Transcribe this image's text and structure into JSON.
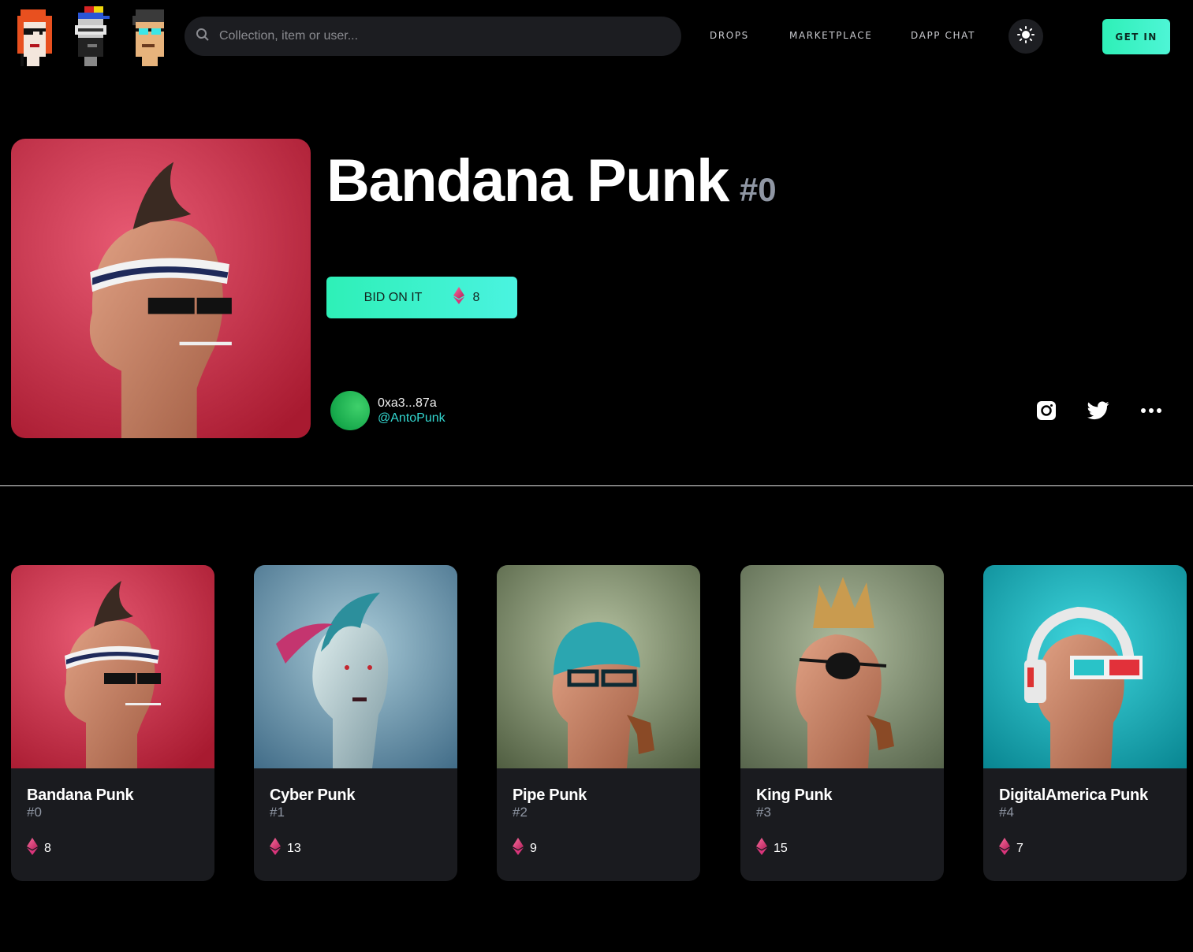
{
  "header": {
    "logos": [
      "punk-avatar-red-hair-icon",
      "punk-avatar-cap-goggles-icon",
      "punk-avatar-glasses-icon"
    ],
    "search_placeholder": "Collection, item or user...",
    "nav": [
      "DROPS",
      "MARKETPLACE",
      "DAPP CHAT"
    ],
    "theme_icon": "sun-icon",
    "get_in_label": "GET IN"
  },
  "hero": {
    "title": "Bandana Punk",
    "number": "#0",
    "bid_label": "BID ON IT",
    "bid_price": "8",
    "owner_address": "0xa3...87a",
    "owner_handle": "@AntoPunk",
    "social_icons": [
      "instagram-icon",
      "twitter-icon",
      "more-icon"
    ]
  },
  "cards": [
    {
      "name": "Bandana Punk",
      "number": "#0",
      "price": "8"
    },
    {
      "name": "Cyber Punk",
      "number": "#1",
      "price": "13"
    },
    {
      "name": "Pipe Punk",
      "number": "#2",
      "price": "9"
    },
    {
      "name": "King Punk",
      "number": "#3",
      "price": "15"
    },
    {
      "name": "DigitalAmerica Punk",
      "number": "#4",
      "price": "7"
    }
  ],
  "colors": {
    "accent": "#2ef0b7",
    "handle": "#33d7d0",
    "card_bg": "#1a1b1f",
    "eth_pink": "#e0407a"
  }
}
